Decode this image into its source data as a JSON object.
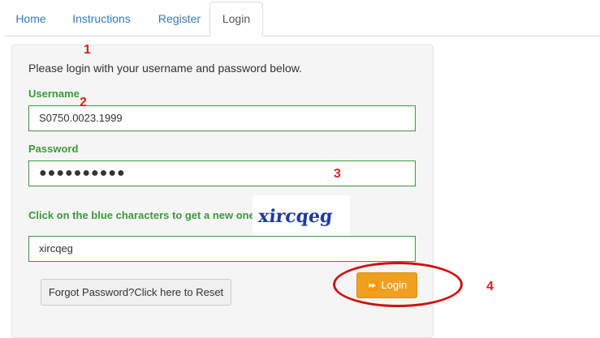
{
  "tabs": {
    "home": "Home",
    "instructions": "Instructions",
    "register": "Register",
    "login": "Login"
  },
  "form": {
    "intro": "Please login with your username and password below.",
    "username_label": "Username",
    "username_value": "S0750.0023.1999",
    "password_label": "Password",
    "password_value": "●●●●●●●●●●",
    "captcha_label": "Click on the blue characters to get a new one",
    "captcha_image_text": "xircqeg",
    "captcha_value": "xircqeg",
    "forgot_label": "Forgot Password?Click here to Reset",
    "login_label": "Login"
  },
  "annotations": {
    "m1": "1",
    "m2": "2",
    "m3": "3",
    "m4": "4"
  },
  "colors": {
    "label_green": "#3c9a3c",
    "link_blue": "#337ab7",
    "button_orange": "#f0a020",
    "annotation_red": "#e02020",
    "captcha_blue": "#1f3b9c"
  }
}
